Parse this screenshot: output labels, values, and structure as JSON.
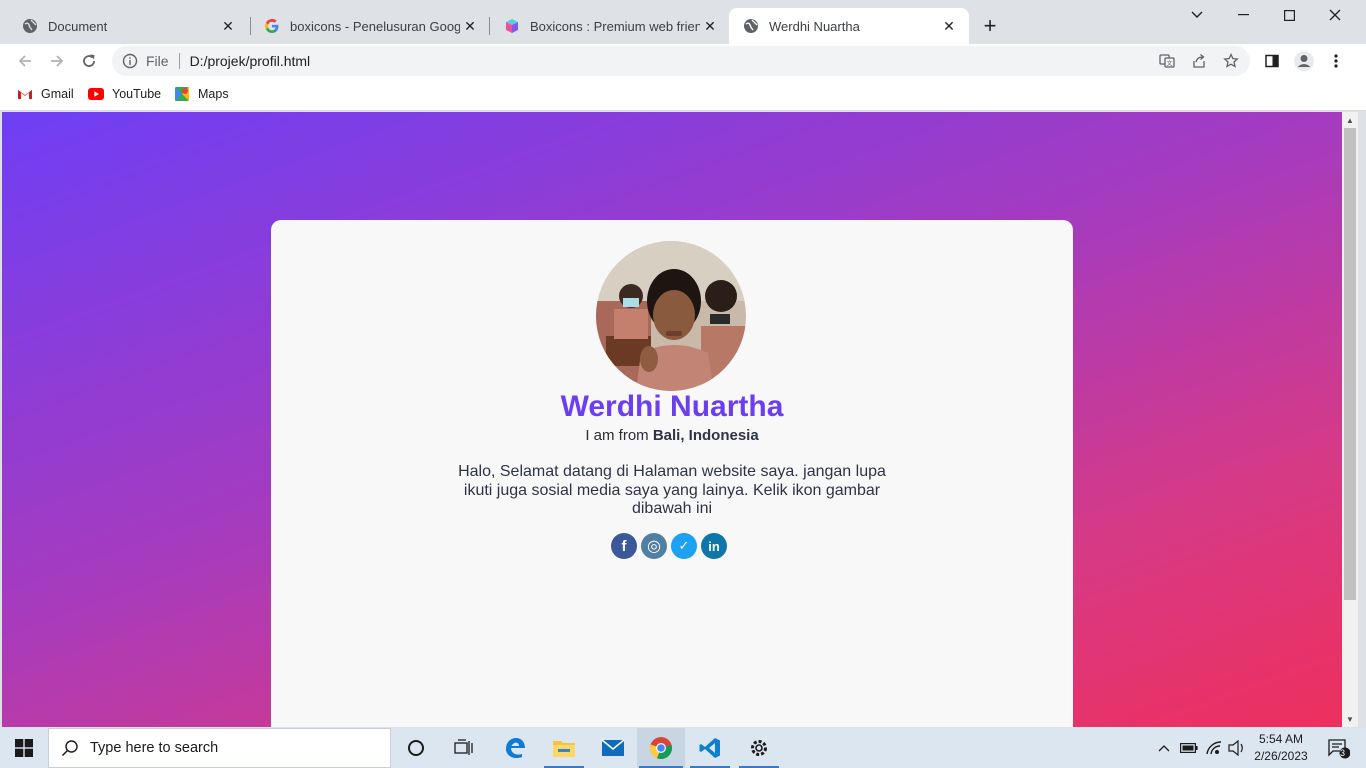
{
  "browser": {
    "tabs": [
      {
        "title": "Document",
        "icon": "globe-icon"
      },
      {
        "title": "boxicons - Penelusuran Google",
        "icon": "google-icon"
      },
      {
        "title": "Boxicons : Premium web friendly",
        "icon": "boxicons-icon"
      },
      {
        "title": "Werdhi Nuartha",
        "icon": "globe-icon"
      }
    ],
    "address": {
      "scheme_label": "File",
      "url": "D:/projek/profil.html"
    },
    "bookmarks": [
      {
        "label": "Gmail",
        "icon": "gmail-icon"
      },
      {
        "label": "YouTube",
        "icon": "youtube-icon"
      },
      {
        "label": "Maps",
        "icon": "maps-icon"
      }
    ]
  },
  "profile": {
    "name": "Werdhi Nuartha",
    "from_prefix": "I am from",
    "location": "Bali, Indonesia",
    "description": "Halo, Selamat datang di Halaman website saya. jangan lupa ikuti juga sosial media saya yang lainya. Kelik ikon gambar dibawah ini",
    "socials": [
      {
        "name": "facebook",
        "glyph": "f",
        "color": "#3b5998"
      },
      {
        "name": "instagram",
        "glyph": "◎",
        "color": "#517fa4"
      },
      {
        "name": "twitter",
        "glyph": "✓",
        "color": "#1da1f2"
      },
      {
        "name": "linkedin",
        "glyph": "in",
        "color": "#0e76a8"
      }
    ],
    "accent_color": "#6c3ef2"
  },
  "taskbar": {
    "search_placeholder": "Type here to search",
    "time": "5:54 AM",
    "date": "2/26/2023",
    "notification_count": "3"
  }
}
